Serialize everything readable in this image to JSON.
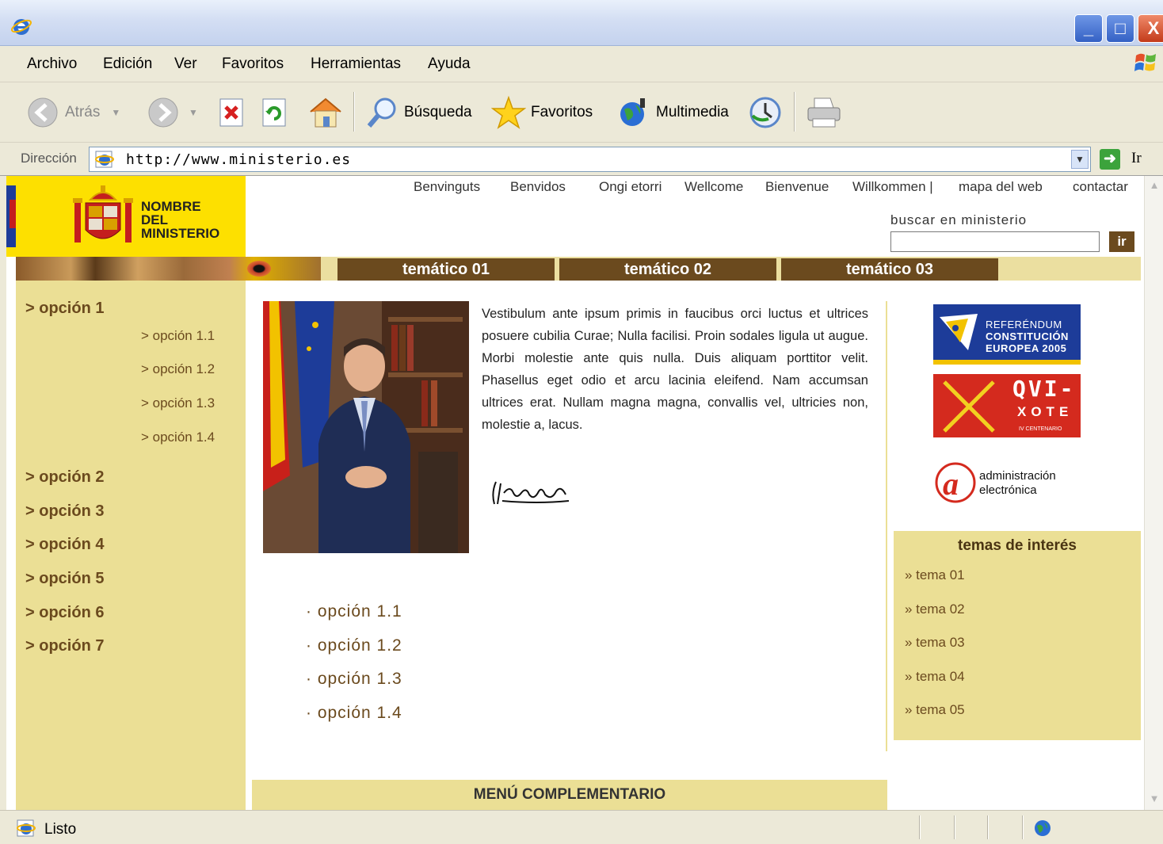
{
  "browser": {
    "menu": [
      "Archivo",
      "Edición",
      "Ver",
      "Favoritos",
      "Herramientas",
      "Ayuda"
    ],
    "toolbar": {
      "back": "Atrás",
      "search": "Búsqueda",
      "favorites": "Favoritos",
      "media": "Multimedia"
    },
    "address_label": "Dirección",
    "url": "http://www.ministerio.es",
    "go": "Ir",
    "status": "Listo"
  },
  "site": {
    "ministry_name": "NOMBRE\nDEL\nMINISTERIO",
    "top_links": [
      "Benvinguts",
      "Benvidos",
      "Ongi etorri",
      "Wellcome",
      "Bienvenue",
      "Willkommen |",
      "mapa del web",
      "contactar"
    ],
    "search_label": "buscar en ministerio",
    "search_button": "ir",
    "nav_tabs": [
      "temático 01",
      "temático 02",
      "temático 03"
    ],
    "left_nav": {
      "main": [
        "> opción 1",
        "> opción 2",
        "> opción 3",
        "> opción 4",
        "> opción 5",
        "> opción 6",
        "> opción 7"
      ],
      "sub": [
        "> opción 1.1",
        "> opción 1.2",
        "> opción 1.3",
        "> opción 1.4"
      ]
    },
    "body_text": "Vestibulum ante ipsum primis in faucibus orci luctus et ultrices posuere cubilia Curae; Nulla facilisi. Proin sodales ligula ut augue. Morbi molestie ante quis nulla. Duis aliquam porttitor velit. Phasellus eget odio et arcu lacinia eleifend. Nam accumsan ultrices erat. Nullam magna magna, convallis vel, ultricies non, molestie a, lacus.",
    "body_list": [
      "· opción 1.1",
      "· opción 1.2",
      "· opción 1.3",
      "· opción 1.4"
    ],
    "menu_complementario": "MENÚ COMPLEMENTARIO",
    "badges": {
      "referendum": [
        "REFERÉNDUM",
        "CONSTITUCIÓN",
        "EUROPEA 2005"
      ],
      "quixote": [
        "QVI-",
        "XOTE",
        "IV CENTENARIO"
      ],
      "admin": [
        "administración",
        "electrónica"
      ]
    },
    "interest_title": "temas de interés",
    "interest_items": [
      "» tema 01",
      "» tema 02",
      "» tema 03",
      "» tema 04",
      "» tema 05"
    ]
  },
  "colors": {
    "brown": "#6b4a1e",
    "sand": "#ebdf95",
    "yellow": "#fde000"
  }
}
